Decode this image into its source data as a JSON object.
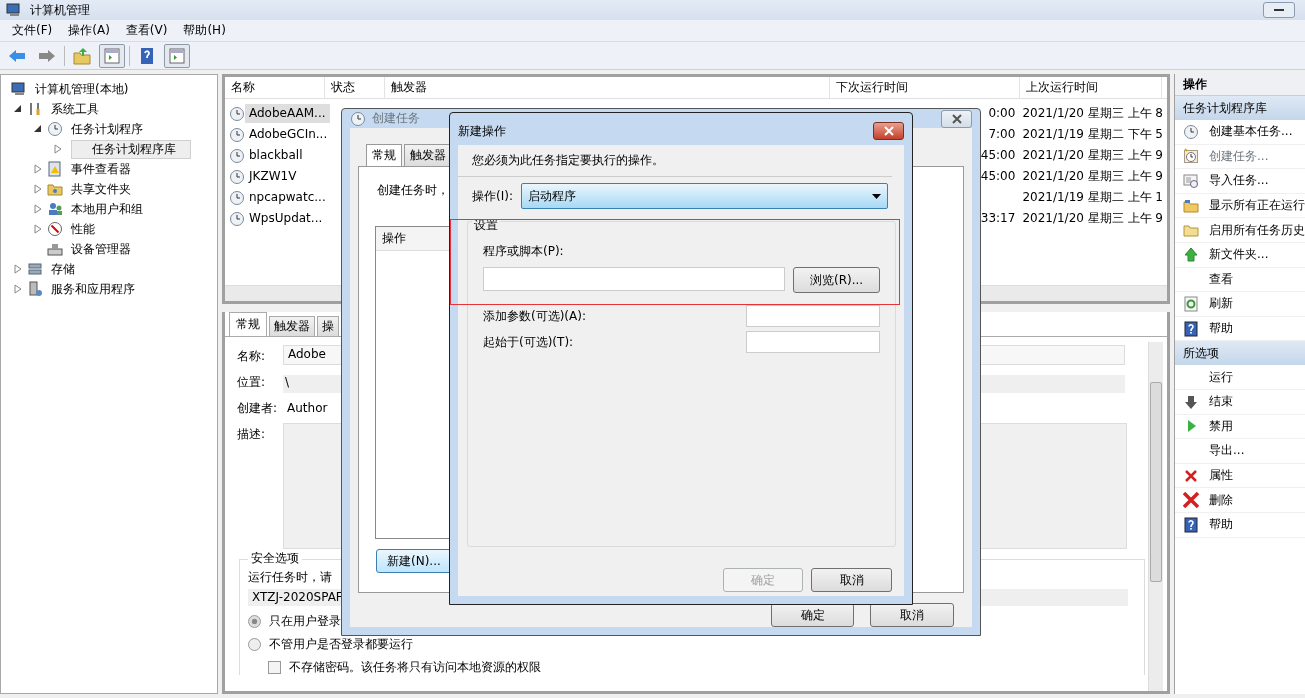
{
  "window": {
    "title": "计算机管理"
  },
  "menu": [
    "文件(F)",
    "操作(A)",
    "查看(V)",
    "帮助(H)"
  ],
  "tree": [
    {
      "label": "计算机管理(本地)",
      "kind": "computer",
      "selected": false,
      "children": [
        {
          "label": "系统工具",
          "kind": "tools",
          "expanded": true,
          "selected": false,
          "children": [
            {
              "label": "任务计划程序",
              "kind": "clock",
              "expanded": true,
              "selected": false,
              "children": [
                {
                  "label": "任务计划程序库",
                  "kind": "none",
                  "expanded": false,
                  "selected": true
                }
              ]
            },
            {
              "label": "事件查看器",
              "kind": "log",
              "expanded": false,
              "selected": false
            },
            {
              "label": "共享文件夹",
              "kind": "share",
              "expanded": false,
              "selected": false
            },
            {
              "label": "本地用户和组",
              "kind": "users",
              "expanded": false,
              "selected": false
            },
            {
              "label": "性能",
              "kind": "gauge",
              "expanded": false,
              "selected": false
            },
            {
              "label": "设备管理器",
              "kind": "device",
              "selected": false
            }
          ]
        },
        {
          "label": "存储",
          "kind": "disk",
          "expanded": false,
          "selected": false
        },
        {
          "label": "服务和应用程序",
          "kind": "server",
          "expanded": false,
          "selected": false
        }
      ]
    }
  ],
  "task_table": {
    "columns": [
      "名称",
      "状态",
      "触发器",
      "下次运行时间",
      "上次运行时间"
    ],
    "rows": [
      {
        "name": "AdobeAAM...",
        "next_run": "0:00",
        "last_run": "2021/1/20 星期三 上午 8",
        "selected": true
      },
      {
        "name": "AdobeGCIn...",
        "next_run": "7:00",
        "last_run": "2021/1/19 星期二 下午 5",
        "selected": false
      },
      {
        "name": "blackball",
        "next_run": "45:00",
        "last_run": "2021/1/20 星期三 上午 9",
        "selected": false
      },
      {
        "name": "JKZW1V",
        "next_run": "45:00",
        "last_run": "2021/1/20 星期三 上午 9",
        "selected": false
      },
      {
        "name": "npcapwatc...",
        "last_run": "2021/1/19 星期二 上午 1",
        "selected": false
      },
      {
        "name": "WpsUpdat...",
        "next_run": "33:17",
        "last_run": "2021/1/20 星期三 上午 9",
        "selected": false
      }
    ]
  },
  "details": {
    "tabs": [
      {
        "label": "常规",
        "selected": true
      },
      {
        "label": "触发器",
        "selected": false
      },
      {
        "label": "操",
        "selected": false
      }
    ],
    "fields": [
      {
        "label": "名称:",
        "value": "Adobe",
        "kind": "box"
      },
      {
        "label": "位置:",
        "value": "\\",
        "kind": "shaded"
      },
      {
        "label": "创建者:",
        "value": "Author",
        "kind": "plain"
      },
      {
        "label": "描述:",
        "kind": "area"
      }
    ],
    "security": {
      "title": "安全选项",
      "prompt": "运行任务时，请",
      "account": "XTZJ-2020SPAF",
      "options": [
        {
          "label": "只在用户登录",
          "selected": true
        },
        {
          "label": "不管用户是否登录都要运行",
          "selected": false
        }
      ],
      "checkbox": {
        "label": "不存储密码。该任务将只有访问本地资源的权限",
        "checked": false
      }
    }
  },
  "actions_pane": {
    "title": "操作",
    "sections": [
      {
        "title": "任务计划程序库",
        "items": [
          {
            "label": "创建基本任务...",
            "kind": "clock",
            "disabled": false
          },
          {
            "label": "创建任务...",
            "kind": "clocknew",
            "disabled": true
          },
          {
            "label": "导入任务...",
            "kind": "import",
            "disabled": false
          },
          {
            "label": "显示所有正在运行",
            "kind": "folderrun",
            "disabled": false
          },
          {
            "label": "启用所有任务历史",
            "kind": "folder",
            "disabled": false
          },
          {
            "label": "新文件夹...",
            "kind": "up",
            "disabled": false
          },
          {
            "label": "查看",
            "kind": "none",
            "disabled": false
          },
          {
            "label": "刷新",
            "kind": "refresh",
            "disabled": false
          },
          {
            "label": "帮助",
            "kind": "help",
            "disabled": false
          }
        ]
      },
      {
        "title": "所选项",
        "items": [
          {
            "label": "运行",
            "kind": "none",
            "disabled": false
          },
          {
            "label": "结束",
            "kind": "down",
            "disabled": false
          },
          {
            "label": "禁用",
            "kind": "play",
            "disabled": false
          },
          {
            "label": "导出...",
            "kind": "none",
            "disabled": false
          },
          {
            "label": "属性",
            "kind": "xsmall",
            "disabled": false
          },
          {
            "label": "删除",
            "kind": "xlarge",
            "disabled": false
          },
          {
            "label": "帮助",
            "kind": "help",
            "disabled": false
          }
        ]
      }
    ]
  },
  "create_task_dialog": {
    "title": "创建任务",
    "tabs": [
      {
        "label": "常规",
        "selected": true
      },
      {
        "label": "触发器",
        "selected": false
      }
    ],
    "intro": "创建任务时，",
    "list_header": "操作",
    "new_button": "新建(N)...",
    "ok": "确定",
    "cancel": "取消"
  },
  "new_action_dialog": {
    "title": "新建操作",
    "instruction": "您必须为此任务指定要执行的操作。",
    "action_label": "操作(I):",
    "action_value": "启动程序",
    "group_title": "设置",
    "program_label": "程序或脚本(P):",
    "browse": "浏览(R)...",
    "args_label": "添加参数(可选)(A):",
    "start_label": "起始于(可选)(T):",
    "ok": {
      "label": "确定",
      "disabled": true
    },
    "cancel": "取消"
  }
}
